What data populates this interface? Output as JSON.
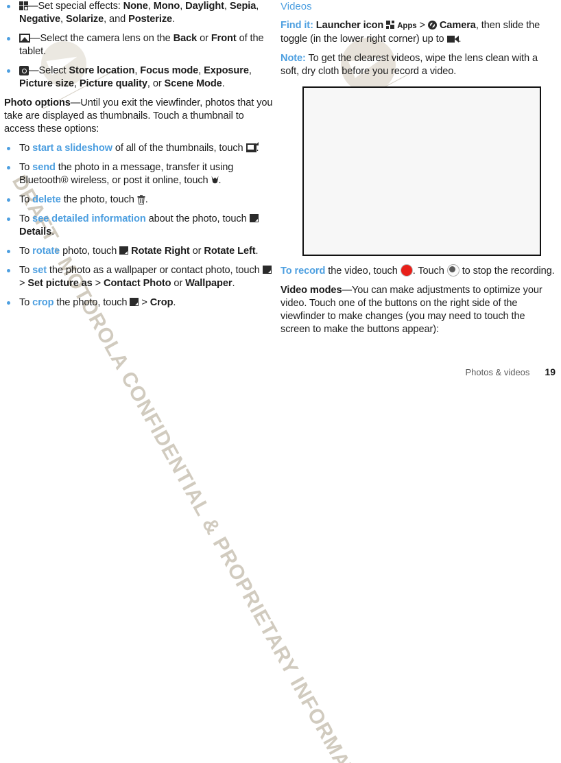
{
  "accent_color": "#4d9fe0",
  "watermark": {
    "text": "DRAFT - MOTOROLA CONFIDENTIAL & PROPRIETARY INFORMATION",
    "logo_name": "motorola-m-logo"
  },
  "left_column": {
    "bullets_effects": [
      {
        "icon": "special-effects-icon",
        "segments": [
          {
            "t": "—Set special effects: ",
            "style": "normal"
          },
          {
            "t": "None",
            "style": "bold"
          },
          {
            "t": ", ",
            "style": "normal"
          },
          {
            "t": "Mono",
            "style": "bold"
          },
          {
            "t": ", ",
            "style": "normal"
          },
          {
            "t": "Daylight",
            "style": "bold"
          },
          {
            "t": ", ",
            "style": "normal"
          },
          {
            "t": "Sepia",
            "style": "bold"
          },
          {
            "t": ", ",
            "style": "normal"
          },
          {
            "t": "Negative",
            "style": "bold"
          },
          {
            "t": ", ",
            "style": "normal"
          },
          {
            "t": "Solarize",
            "style": "bold"
          },
          {
            "t": ", and ",
            "style": "normal"
          },
          {
            "t": "Posterize",
            "style": "bold"
          },
          {
            "t": ".",
            "style": "normal"
          }
        ]
      },
      {
        "icon": "camera-lens-icon",
        "segments": [
          {
            "t": "—Select the camera lens on the ",
            "style": "normal"
          },
          {
            "t": "Back",
            "style": "bold"
          },
          {
            "t": " or ",
            "style": "normal"
          },
          {
            "t": "Front",
            "style": "bold"
          },
          {
            "t": " of the tablet.",
            "style": "normal"
          }
        ]
      },
      {
        "icon": "settings-icon",
        "segments": [
          {
            "t": "—Select ",
            "style": "normal"
          },
          {
            "t": "Store location",
            "style": "bold"
          },
          {
            "t": ", ",
            "style": "normal"
          },
          {
            "t": "Focus mode",
            "style": "bold"
          },
          {
            "t": ", ",
            "style": "normal"
          },
          {
            "t": "Exposure",
            "style": "bold"
          },
          {
            "t": ", ",
            "style": "normal"
          },
          {
            "t": "Picture size",
            "style": "bold"
          },
          {
            "t": ", ",
            "style": "normal"
          },
          {
            "t": "Picture quality",
            "style": "bold"
          },
          {
            "t": ", or ",
            "style": "normal"
          },
          {
            "t": "Scene Mode",
            "style": "bold"
          },
          {
            "t": ".",
            "style": "normal"
          }
        ]
      }
    ],
    "photo_options_paragraph": {
      "lead": "Photo options",
      "body": "—Until you exit the viewfinder, photos that you take are displayed as thumbnails. Touch a thumbnail to access these options:"
    },
    "photo_bullets": [
      {
        "name": "slideshow-bullet",
        "segments": [
          {
            "t": "To ",
            "style": "normal"
          },
          {
            "t": "start a slideshow",
            "style": "link"
          },
          {
            "t": " of all of the thumbnails, touch ",
            "style": "normal"
          },
          {
            "t": "",
            "style": "icon",
            "icon": "slideshow-icon"
          },
          {
            "t": ".",
            "style": "normal"
          }
        ]
      },
      {
        "name": "send-bullet",
        "segments": [
          {
            "t": "To ",
            "style": "normal"
          },
          {
            "t": "send",
            "style": "link"
          },
          {
            "t": " the photo in a message, transfer it using Bluetooth® wireless, or post it online, touch ",
            "style": "normal"
          },
          {
            "t": "",
            "style": "icon",
            "icon": "share-icon"
          },
          {
            "t": ".",
            "style": "normal"
          }
        ]
      },
      {
        "name": "delete-bullet",
        "segments": [
          {
            "t": "To ",
            "style": "normal"
          },
          {
            "t": "delete",
            "style": "link"
          },
          {
            "t": " the photo, touch ",
            "style": "normal"
          },
          {
            "t": "",
            "style": "icon",
            "icon": "trash-icon"
          },
          {
            "t": ".",
            "style": "normal"
          }
        ]
      },
      {
        "name": "details-bullet",
        "segments": [
          {
            "t": "To ",
            "style": "normal"
          },
          {
            "t": "see detailed information",
            "style": "link"
          },
          {
            "t": " about the photo, touch ",
            "style": "normal"
          },
          {
            "t": "",
            "style": "icon",
            "icon": "menu-icon"
          },
          {
            "t": " ",
            "style": "normal"
          },
          {
            "t": "Details",
            "style": "bold"
          },
          {
            "t": ".",
            "style": "normal"
          }
        ]
      },
      {
        "name": "rotate-bullet",
        "segments": [
          {
            "t": "To ",
            "style": "normal"
          },
          {
            "t": "rotate",
            "style": "link"
          },
          {
            "t": " photo, touch ",
            "style": "normal"
          },
          {
            "t": "",
            "style": "icon",
            "icon": "menu-icon"
          },
          {
            "t": " ",
            "style": "normal"
          },
          {
            "t": "Rotate Right",
            "style": "bold"
          },
          {
            "t": " or ",
            "style": "normal"
          },
          {
            "t": "Rotate Left",
            "style": "bold"
          },
          {
            "t": ".",
            "style": "normal"
          }
        ]
      },
      {
        "name": "set-wallpaper-bullet",
        "segments": [
          {
            "t": "To ",
            "style": "normal"
          },
          {
            "t": "set",
            "style": "link"
          },
          {
            "t": " the photo as a wallpaper or contact photo, touch ",
            "style": "normal"
          },
          {
            "t": "",
            "style": "icon",
            "icon": "menu-icon"
          },
          {
            "t": " > ",
            "style": "normal"
          },
          {
            "t": "Set picture as",
            "style": "bold"
          },
          {
            "t": " > ",
            "style": "normal"
          },
          {
            "t": "Contact Photo",
            "style": "bold"
          },
          {
            "t": " or ",
            "style": "normal"
          },
          {
            "t": "Wallpaper",
            "style": "bold"
          },
          {
            "t": ".",
            "style": "normal"
          }
        ]
      },
      {
        "name": "crop-bullet",
        "segments": [
          {
            "t": "To ",
            "style": "normal"
          },
          {
            "t": "crop",
            "style": "link"
          },
          {
            "t": " the photo, touch ",
            "style": "normal"
          },
          {
            "t": "",
            "style": "icon",
            "icon": "menu-icon"
          },
          {
            "t": " > ",
            "style": "normal"
          },
          {
            "t": "Crop",
            "style": "bold"
          },
          {
            "t": ".",
            "style": "normal"
          }
        ]
      }
    ]
  },
  "right_column": {
    "section_heading": "Videos",
    "find_it": {
      "segments": [
        {
          "t": "Find it:",
          "style": "link"
        },
        {
          "t": " ",
          "style": "normal"
        },
        {
          "t": "Launcher icon",
          "style": "bold"
        },
        {
          "t": " ",
          "style": "normal"
        },
        {
          "t": "",
          "style": "icon",
          "icon": "apps-grid-icon"
        },
        {
          "t": " ",
          "style": "normal"
        },
        {
          "t": "Apps",
          "style": "bold-small"
        },
        {
          "t": " > ",
          "style": "normal"
        },
        {
          "t": "",
          "style": "icon",
          "icon": "camera-app-icon"
        },
        {
          "t": " ",
          "style": "normal"
        },
        {
          "t": "Camera",
          "style": "bold"
        },
        {
          "t": ", then slide the toggle (in the lower right corner) up to ",
          "style": "normal"
        },
        {
          "t": "",
          "style": "icon",
          "icon": "video-camera-icon"
        },
        {
          "t": ".",
          "style": "normal"
        }
      ]
    },
    "note": {
      "segments": [
        {
          "t": "Note:",
          "style": "link"
        },
        {
          "t": " To get the clearest videos, wipe the lens clean with a soft, dry cloth before you record a video.",
          "style": "normal"
        }
      ]
    },
    "figure": {
      "name": "video-viewfinder-figure"
    },
    "to_record": {
      "segments": [
        {
          "t": "To record",
          "style": "link"
        },
        {
          "t": " the video, touch ",
          "style": "normal"
        },
        {
          "t": "",
          "style": "icon",
          "icon": "record-button-icon"
        },
        {
          "t": ". Touch ",
          "style": "normal"
        },
        {
          "t": "",
          "style": "icon",
          "icon": "stop-button-icon"
        },
        {
          "t": " to stop the recording.",
          "style": "normal"
        }
      ]
    },
    "video_modes": {
      "segments": [
        {
          "t": "Video modes",
          "style": "bold"
        },
        {
          "t": "—You can make adjustments to optimize your video. Touch one of the buttons on the right side of the viewfinder to make changes (you may need to touch the screen to make the buttons appear):",
          "style": "normal"
        }
      ]
    }
  },
  "footer": {
    "label": "Photos & videos",
    "page": "19"
  }
}
